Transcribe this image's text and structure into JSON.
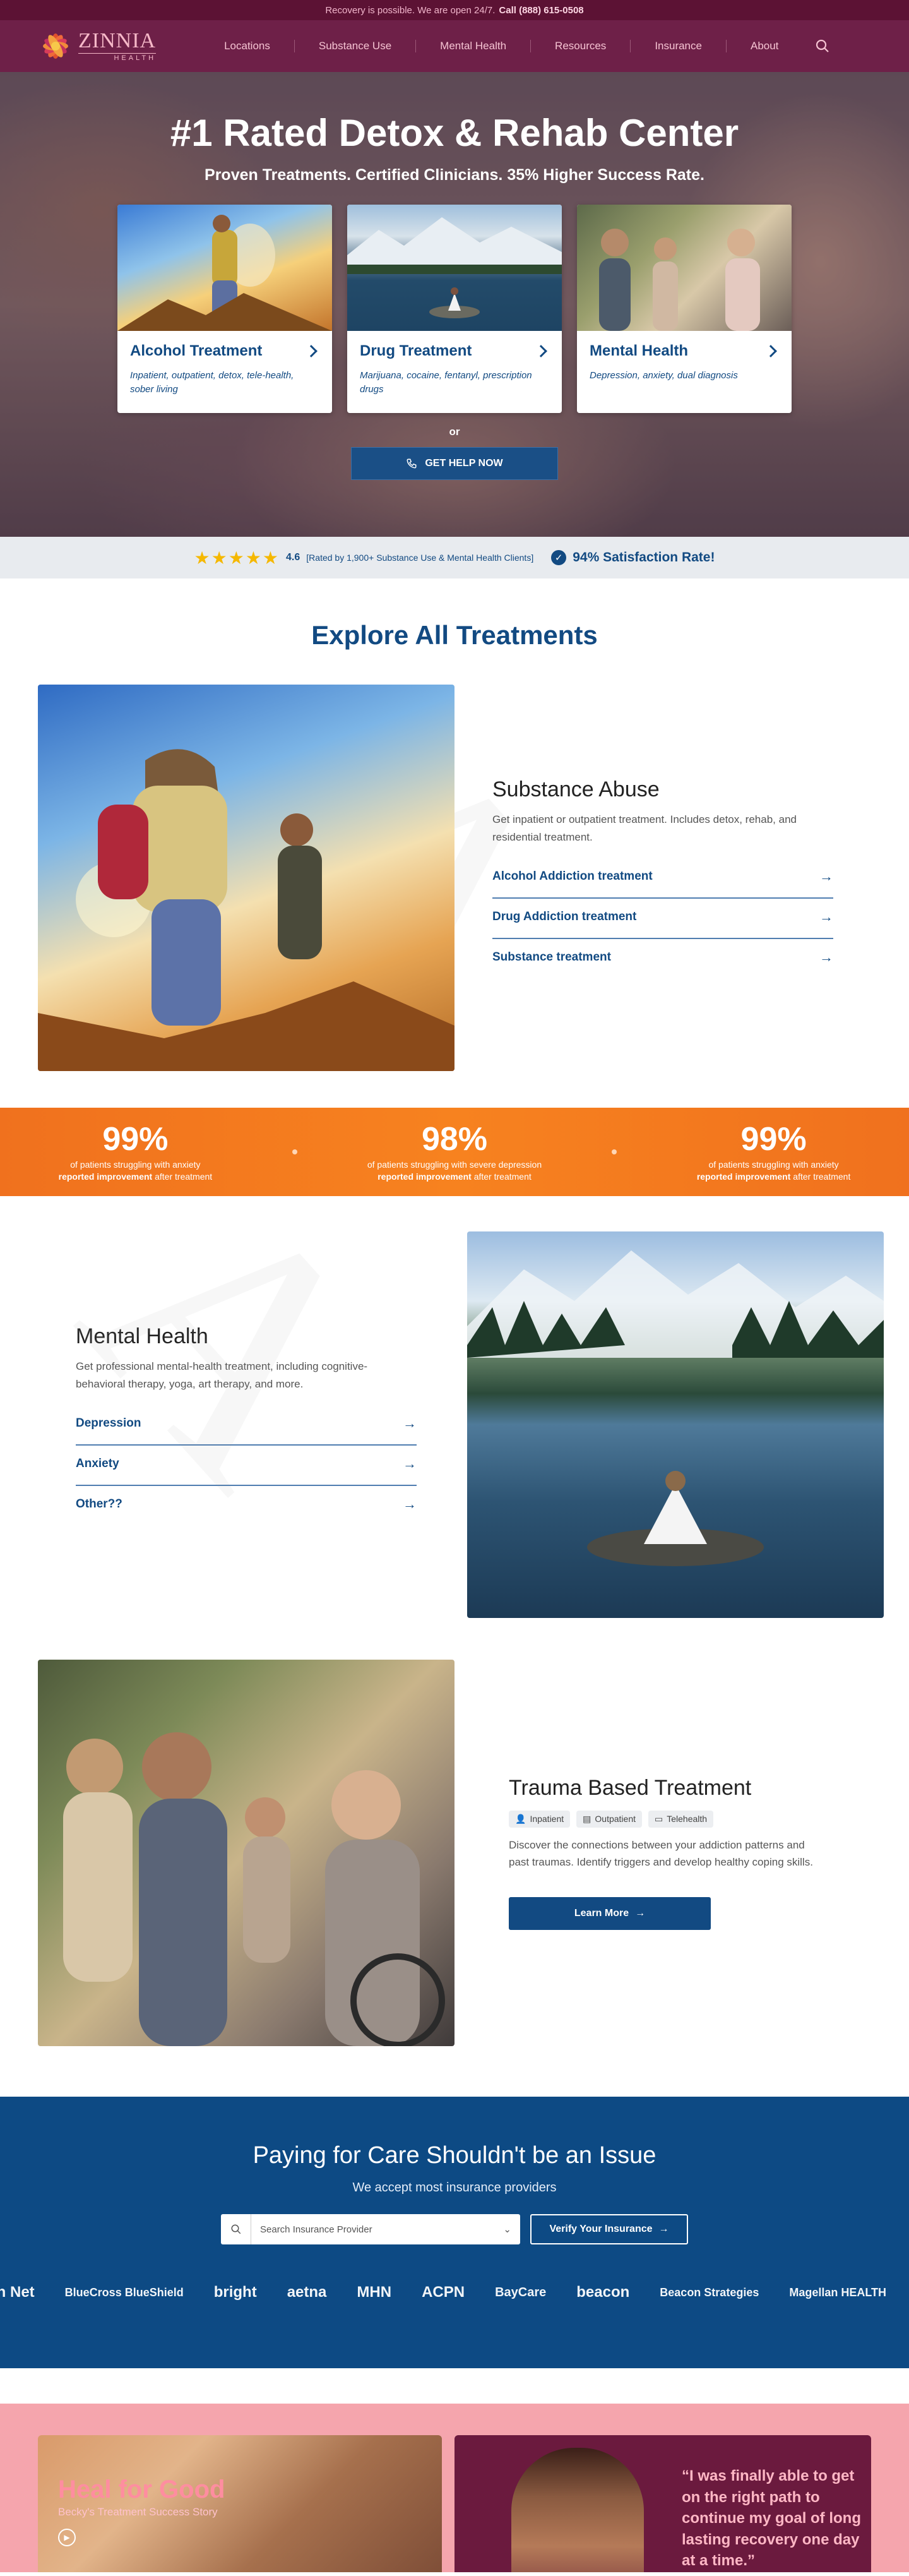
{
  "topbar": {
    "text": "Recovery is possible. We are open 24/7.",
    "phone": "Call (888) 615-0508"
  },
  "brand": {
    "name": "ZINNIA",
    "sub": "HEALTH"
  },
  "nav": {
    "items": [
      "Locations",
      "Substance Use",
      "Mental Health",
      "Resources",
      "Insurance",
      "About"
    ]
  },
  "hero": {
    "title": "#1 Rated Detox & Rehab Center",
    "subtitle": "Proven Treatments. Certified Clinicians. 35% Higher Success Rate.",
    "cards": [
      {
        "title": "Alcohol Treatment",
        "desc": "Inpatient, outpatient, detox, tele-health, sober living"
      },
      {
        "title": "Drug Treatment",
        "desc": "Marijuana, cocaine, fentanyl, prescription drugs"
      },
      {
        "title": "Mental Health",
        "desc": "Depression, anxiety, dual diagnosis"
      }
    ],
    "or": "or",
    "help_button": "GET HELP NOW"
  },
  "rating": {
    "stars": "★★★★★",
    "score": "4.6",
    "rated_by": "[Rated by 1,900+ Substance Use & Mental Health Clients]",
    "satisfaction": "94% Satisfaction Rate!"
  },
  "explore": {
    "title": "Explore All Treatments",
    "substance": {
      "heading": "Substance Abuse",
      "desc": "Get inpatient or outpatient treatment. Includes detox, rehab, and residential treatment.",
      "links": [
        "Alcohol Addiction treatment",
        "Drug Addiction treatment",
        "Substance treatment"
      ]
    },
    "mental": {
      "heading": "Mental Health",
      "desc": "Get professional mental-health treatment, including cognitive-behavioral therapy, yoga, art therapy, and more.",
      "links": [
        "Depression",
        "Anxiety",
        "Other??"
      ]
    },
    "trauma": {
      "heading": "Trauma Based Treatment",
      "chips": [
        "Inpatient",
        "Outpatient",
        "Telehealth"
      ],
      "desc": "Discover the connections between your addiction patterns and past traumas. Identify triggers and develop healthy coping skills.",
      "button": "Learn More"
    }
  },
  "stats": [
    {
      "value": "99%",
      "line1": "of patients struggling with anxiety",
      "bold": "reported improvement",
      "tail": " after treatment"
    },
    {
      "value": "98%",
      "line1": "of patients struggling with severe depression",
      "bold": "reported improvement",
      "tail": " after treatment"
    },
    {
      "value": "99%",
      "line1": "of patients struggling with anxiety",
      "bold": "reported improvement",
      "tail": " after treatment"
    }
  ],
  "insurance": {
    "title": "Paying for Care Shouldn't be an Issue",
    "subtitle": "We accept most insurance providers",
    "placeholder": "Search Insurance Provider",
    "verify": "Verify Your Insurance",
    "logos": [
      "lth Net",
      "BlueCross BlueShield",
      "bright",
      "aetna",
      "MHN",
      "ACPN",
      "BayCare",
      "beacon",
      "Beacon Strategies",
      "Magellan HEALTH"
    ]
  },
  "stories": {
    "left_title": "Heal for Good",
    "left_sub": "Becky's Treatment Success Story",
    "quote": "“I was finally able to get on the right path to continue my goal of long lasting recovery one day at a time.”"
  },
  "colors": {
    "primary": "#124a82",
    "nav": "#6e2048",
    "accent": "#f7821f",
    "pink": "#f5a5ad"
  }
}
